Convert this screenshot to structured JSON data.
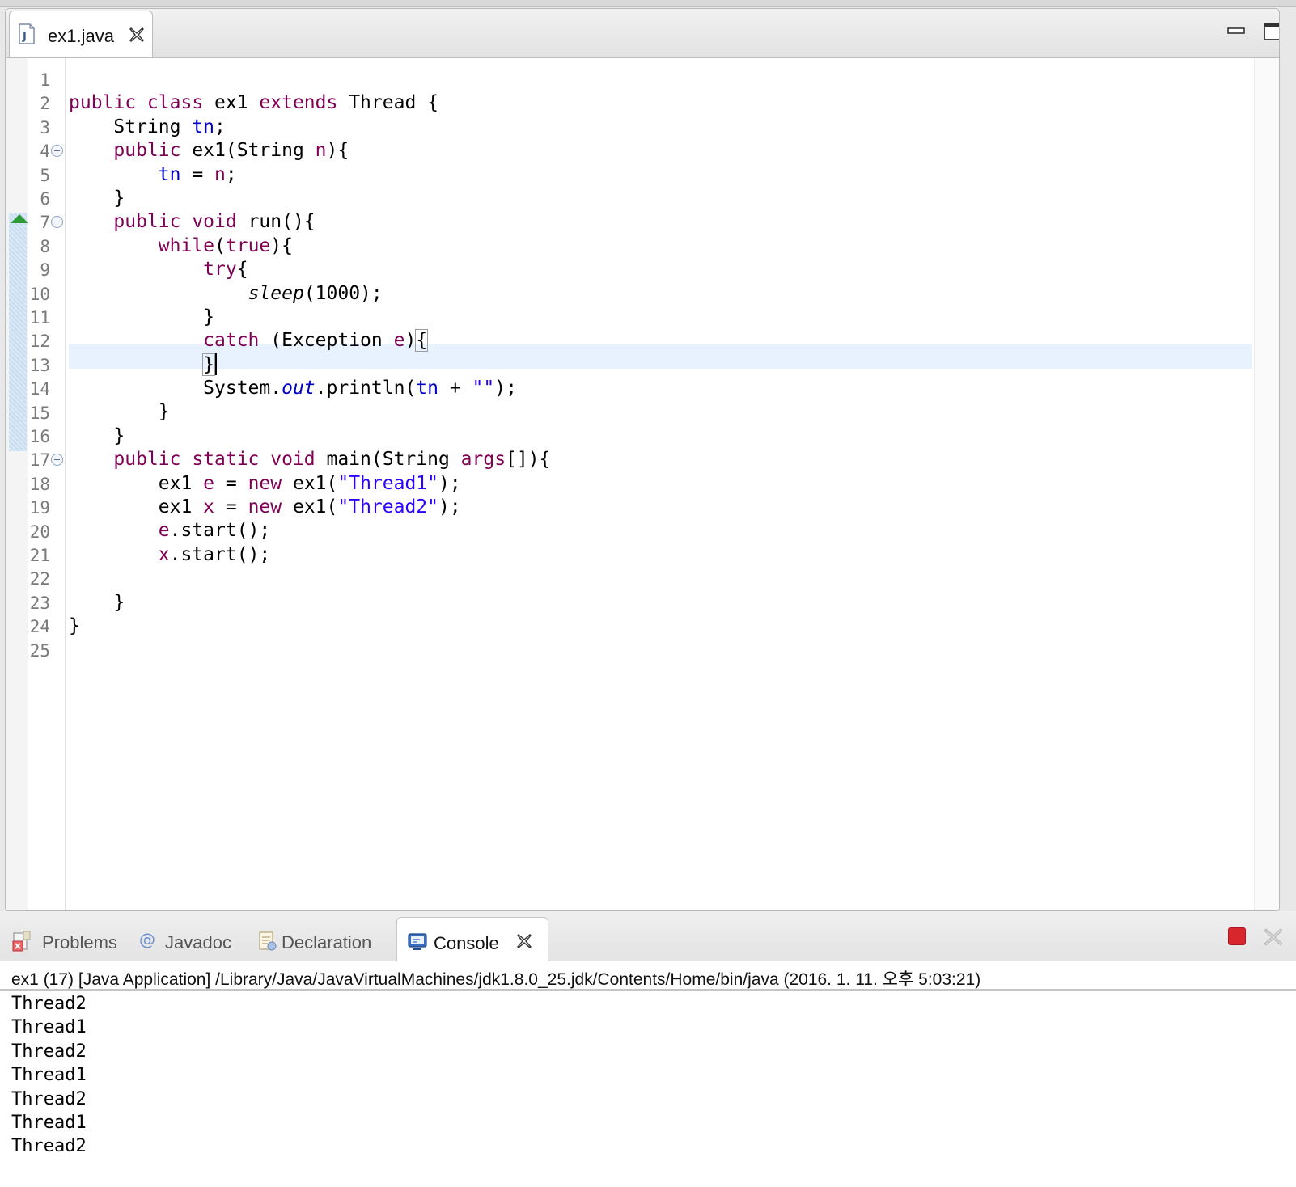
{
  "editor": {
    "tab_title": "ex1.java",
    "icons": {
      "file": "java-file-icon",
      "close": "close-icon",
      "minimize": "minimize-icon",
      "maximize": "maximize-icon"
    },
    "line_numbers": [
      "1",
      "2",
      "3",
      "4",
      "5",
      "6",
      "7",
      "8",
      "9",
      "10",
      "11",
      "12",
      "13",
      "14",
      "15",
      "16",
      "17",
      "18",
      "19",
      "20",
      "21",
      "22",
      "23",
      "24",
      "25"
    ],
    "current_line": 13,
    "code": [
      [],
      [
        {
          "t": "public class",
          "c": "kw"
        },
        {
          "t": " ex1 "
        },
        {
          "t": "extends",
          "c": "kw"
        },
        {
          "t": " Thread {"
        }
      ],
      [
        {
          "t": "    String "
        },
        {
          "t": "tn",
          "c": "fld"
        },
        {
          "t": ";"
        }
      ],
      [
        {
          "t": "    "
        },
        {
          "t": "public",
          "c": "kw"
        },
        {
          "t": " ex1(String "
        },
        {
          "t": "n",
          "c": "kw"
        },
        {
          "t": "){"
        }
      ],
      [
        {
          "t": "        "
        },
        {
          "t": "tn",
          "c": "fld"
        },
        {
          "t": " = "
        },
        {
          "t": "n",
          "c": "kw"
        },
        {
          "t": ";"
        }
      ],
      [
        {
          "t": "    }"
        }
      ],
      [
        {
          "t": "    "
        },
        {
          "t": "public void",
          "c": "kw"
        },
        {
          "t": " run(){"
        }
      ],
      [
        {
          "t": "        "
        },
        {
          "t": "while",
          "c": "kw"
        },
        {
          "t": "("
        },
        {
          "t": "true",
          "c": "kw"
        },
        {
          "t": "){"
        }
      ],
      [
        {
          "t": "            "
        },
        {
          "t": "try",
          "c": "kw"
        },
        {
          "t": "{"
        }
      ],
      [
        {
          "t": "                "
        },
        {
          "t": "sleep",
          "c": "static-m"
        },
        {
          "t": "(1000);"
        }
      ],
      [
        {
          "t": "            }"
        }
      ],
      [
        {
          "t": "            "
        },
        {
          "t": "catch",
          "c": "kw"
        },
        {
          "t": " (Exception "
        },
        {
          "t": "e",
          "c": "kw"
        },
        {
          "t": ")"
        },
        {
          "t": "{",
          "c": "brk"
        }
      ],
      [
        {
          "t": "            "
        },
        {
          "t": "}",
          "c": "brk"
        },
        {
          "t": "",
          "c": "caret"
        }
      ],
      [
        {
          "t": "            System."
        },
        {
          "t": "out",
          "c": "static-fld"
        },
        {
          "t": ".println("
        },
        {
          "t": "tn",
          "c": "fld"
        },
        {
          "t": " + "
        },
        {
          "t": "\"\"",
          "c": "str"
        },
        {
          "t": ");"
        }
      ],
      [
        {
          "t": "        }"
        }
      ],
      [
        {
          "t": "    }"
        }
      ],
      [
        {
          "t": "    "
        },
        {
          "t": "public static void",
          "c": "kw"
        },
        {
          "t": " main(String "
        },
        {
          "t": "args",
          "c": "kw"
        },
        {
          "t": "[]){"
        }
      ],
      [
        {
          "t": "        ex1 "
        },
        {
          "t": "e",
          "c": "kw"
        },
        {
          "t": " = "
        },
        {
          "t": "new",
          "c": "kw"
        },
        {
          "t": " ex1("
        },
        {
          "t": "\"Thread1\"",
          "c": "str"
        },
        {
          "t": ");"
        }
      ],
      [
        {
          "t": "        ex1 "
        },
        {
          "t": "x",
          "c": "kw"
        },
        {
          "t": " = "
        },
        {
          "t": "new",
          "c": "kw"
        },
        {
          "t": " ex1("
        },
        {
          "t": "\"Thread2\"",
          "c": "str"
        },
        {
          "t": ");"
        }
      ],
      [
        {
          "t": "        "
        },
        {
          "t": "e",
          "c": "kw"
        },
        {
          "t": ".start();"
        }
      ],
      [
        {
          "t": "        "
        },
        {
          "t": "x",
          "c": "kw"
        },
        {
          "t": ".start();"
        }
      ],
      [],
      [
        {
          "t": "    }"
        }
      ],
      [
        {
          "t": "}"
        }
      ],
      []
    ]
  },
  "console": {
    "tabs": [
      {
        "label": "Problems",
        "icon": "problems-icon",
        "active": false
      },
      {
        "label": "Javadoc",
        "icon": "javadoc-icon",
        "active": false
      },
      {
        "label": "Declaration",
        "icon": "declaration-icon",
        "active": false
      },
      {
        "label": "Console",
        "icon": "console-icon",
        "active": true
      }
    ],
    "description": "ex1 (17) [Java Application] /Library/Java/JavaVirtualMachines/jdk1.8.0_25.jdk/Contents/Home/bin/java (2016. 1. 11. 오후 5:03:21)",
    "output": [
      "Thread2",
      "Thread1",
      "Thread2",
      "Thread1",
      "Thread2",
      "Thread1",
      "Thread2"
    ],
    "actions": {
      "terminate": "terminate-icon",
      "remove": "remove-launch-icon"
    }
  },
  "colors": {
    "keyword": "#7f0055",
    "field": "#0000c0",
    "string": "#2a00ff",
    "current_line": "#e8f2fe",
    "terminate": "#d9262c"
  }
}
